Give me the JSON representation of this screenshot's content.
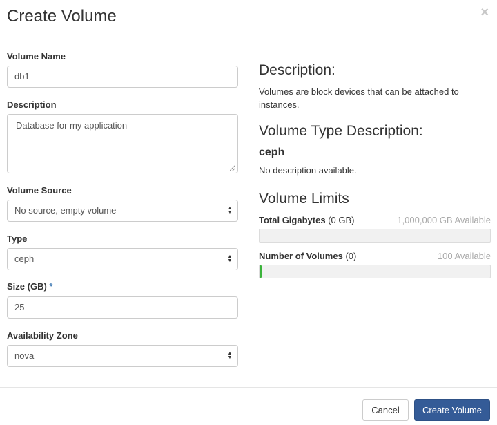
{
  "dialog": {
    "title": "Create Volume",
    "close_glyph": "×"
  },
  "form": {
    "volume_name": {
      "label": "Volume Name",
      "value": "db1"
    },
    "description": {
      "label": "Description",
      "value": "Database for my application"
    },
    "volume_source": {
      "label": "Volume Source",
      "selected": "No source, empty volume"
    },
    "type": {
      "label": "Type",
      "selected": "ceph"
    },
    "size": {
      "label": "Size (GB)",
      "required_mark": "*",
      "value": "25"
    },
    "availability_zone": {
      "label": "Availability Zone",
      "selected": "nova"
    }
  },
  "info": {
    "description_heading": "Description:",
    "description_text": "Volumes are block devices that can be attached to instances.",
    "type_heading": "Volume Type Description:",
    "type_name": "ceph",
    "type_text": "No description available.",
    "limits_heading": "Volume Limits",
    "limits": [
      {
        "name": "Total Gigabytes",
        "used": "(0 GB)",
        "available": "1,000,000 GB Available",
        "fraction": 0.0
      },
      {
        "name": "Number of Volumes",
        "used": "(0)",
        "available": "100 Available",
        "fraction": 0.01
      }
    ]
  },
  "footer": {
    "cancel_label": "Cancel",
    "create_label": "Create Volume"
  },
  "colors": {
    "primary": "#345b97",
    "bar_fill": "#3bb33b",
    "required": "#3774b1"
  }
}
